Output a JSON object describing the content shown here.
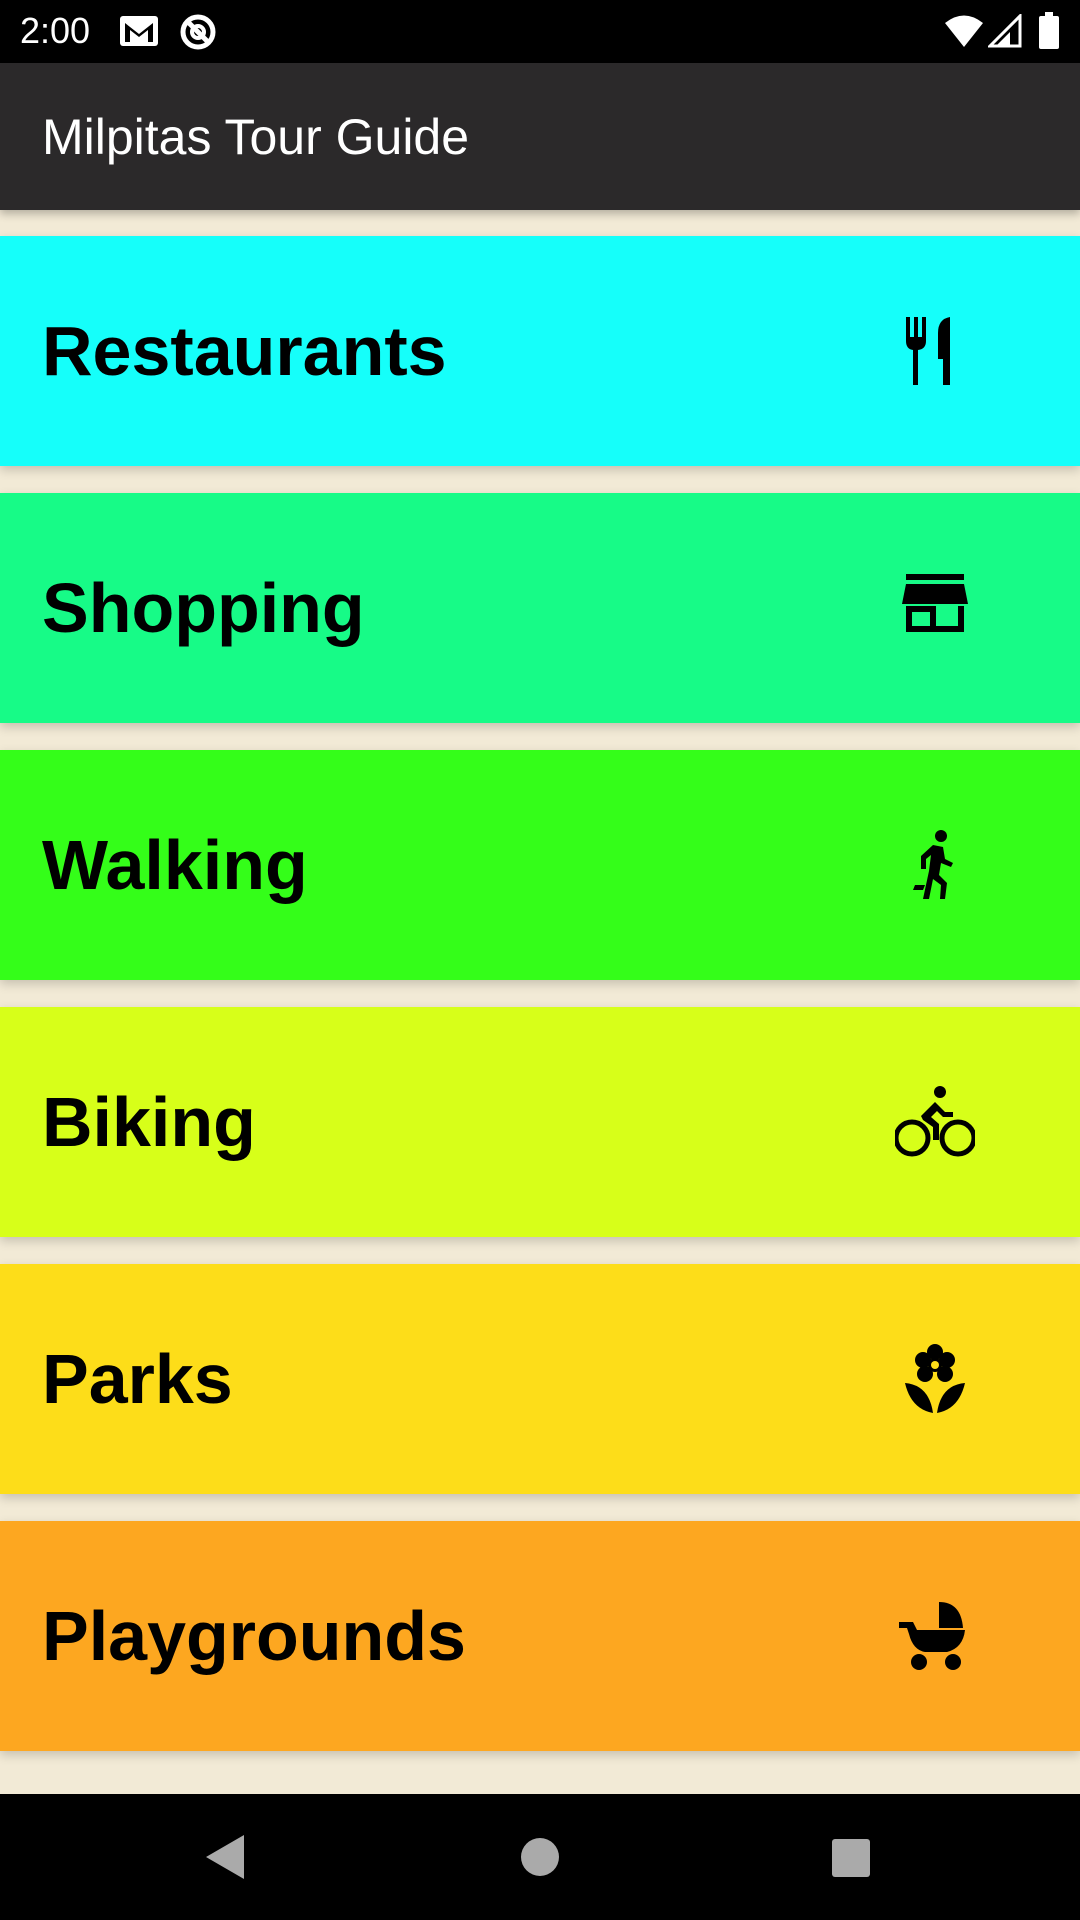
{
  "status_bar": {
    "time": "2:00",
    "icons": [
      "gmail-icon",
      "at-sign-icon",
      "wifi-icon",
      "cell-signal-icon",
      "battery-icon"
    ]
  },
  "app_bar": {
    "title": "Milpitas Tour Guide",
    "background_color": "#2b292a"
  },
  "categories": [
    {
      "label": "Restaurants",
      "icon": "restaurant-icon",
      "color": "#15fffa"
    },
    {
      "label": "Shopping",
      "icon": "store-icon",
      "color": "#17fb87"
    },
    {
      "label": "Walking",
      "icon": "walking-icon",
      "color": "#34fe19"
    },
    {
      "label": "Biking",
      "icon": "bike-icon",
      "color": "#d7ff19"
    },
    {
      "label": "Parks",
      "icon": "flower-icon",
      "color": "#fddd19"
    },
    {
      "label": "Playgrounds",
      "icon": "stroller-icon",
      "color": "#fda720"
    }
  ],
  "list_background_color": "#f2ead6",
  "nav_bar": {
    "buttons": [
      "back-button",
      "home-button",
      "recents-button"
    ]
  }
}
